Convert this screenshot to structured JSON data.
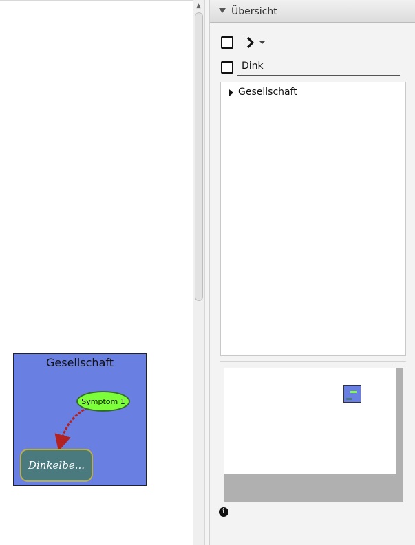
{
  "panel": {
    "title": "Übersicht",
    "filter_value": "Dink",
    "tree_items": [
      {
        "label": "Gesellschaft",
        "expanded": false
      }
    ]
  },
  "map": {
    "title": "Gesellschaft",
    "background": "#6a7fe2",
    "nodes": [
      {
        "label": "Symptom 1",
        "color": "#7cff3a"
      },
      {
        "label": "Dinkelbe...",
        "color": "#4a7a7e"
      }
    ],
    "connector_color": "#b22222"
  },
  "icons": {
    "info": "info-icon",
    "expand": "chevron-right-icon",
    "dropdown": "caret-down-icon"
  }
}
